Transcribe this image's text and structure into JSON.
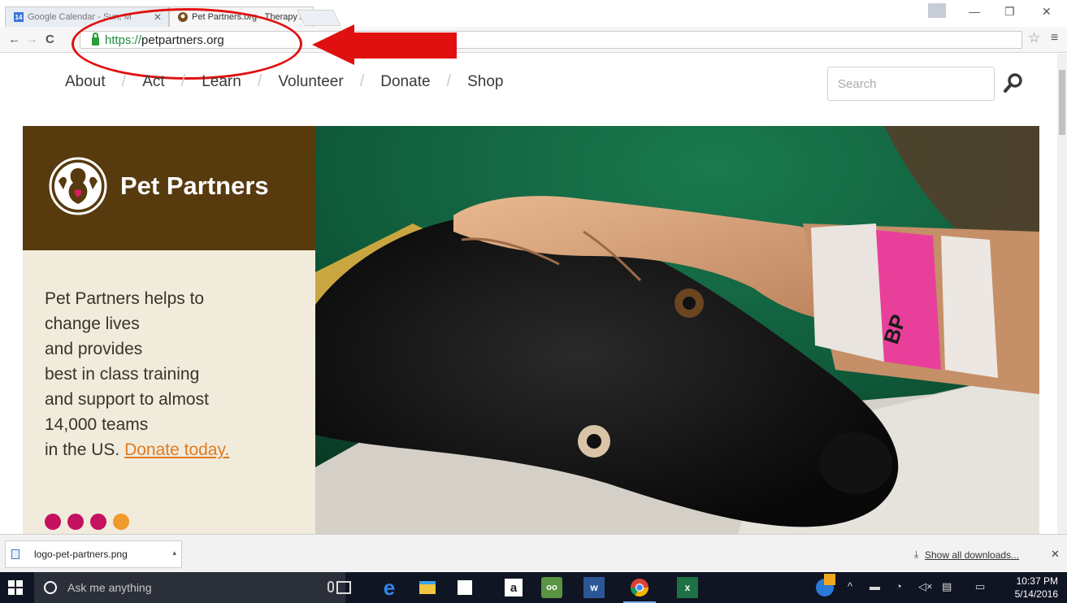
{
  "browser": {
    "tabs": [
      {
        "label": "Google Calendar - Sun, M",
        "favicon": "calendar-icon",
        "favicon_text": "14"
      },
      {
        "label": "Pet Partners.org - Therapy",
        "favicon": "pet-partners-icon"
      }
    ],
    "url_scheme": "https://",
    "url_host": "petpartners.org"
  },
  "site": {
    "nav": [
      "About",
      "Act",
      "Learn",
      "Volunteer",
      "Donate",
      "Shop"
    ],
    "search_placeholder": "Search",
    "logo_text": "Pet Partners",
    "tagline_lines": [
      "Pet Partners helps to",
      "change lives",
      "and provides",
      "best in class training",
      "and support to almost",
      "14,000 teams"
    ],
    "tagline_last_prefix": "in the US. ",
    "donate_link": "Donate today.",
    "dot_colors": [
      "#c5115f",
      "#c5115f",
      "#c5115f",
      "#f09a2b"
    ],
    "photo_wristband_text": "BP"
  },
  "downloads": {
    "file_name": "logo-pet-partners.png",
    "show_all": "Show all downloads..."
  },
  "taskbar": {
    "search_placeholder": "Ask me anything",
    "time": "10:37 PM",
    "date": "5/14/2016"
  },
  "colors": {
    "logo_bg": "#573a0e",
    "text_panel_bg": "#f1ebdc",
    "donate_link": "#e07b1f",
    "annotation_red": "#e01010"
  }
}
